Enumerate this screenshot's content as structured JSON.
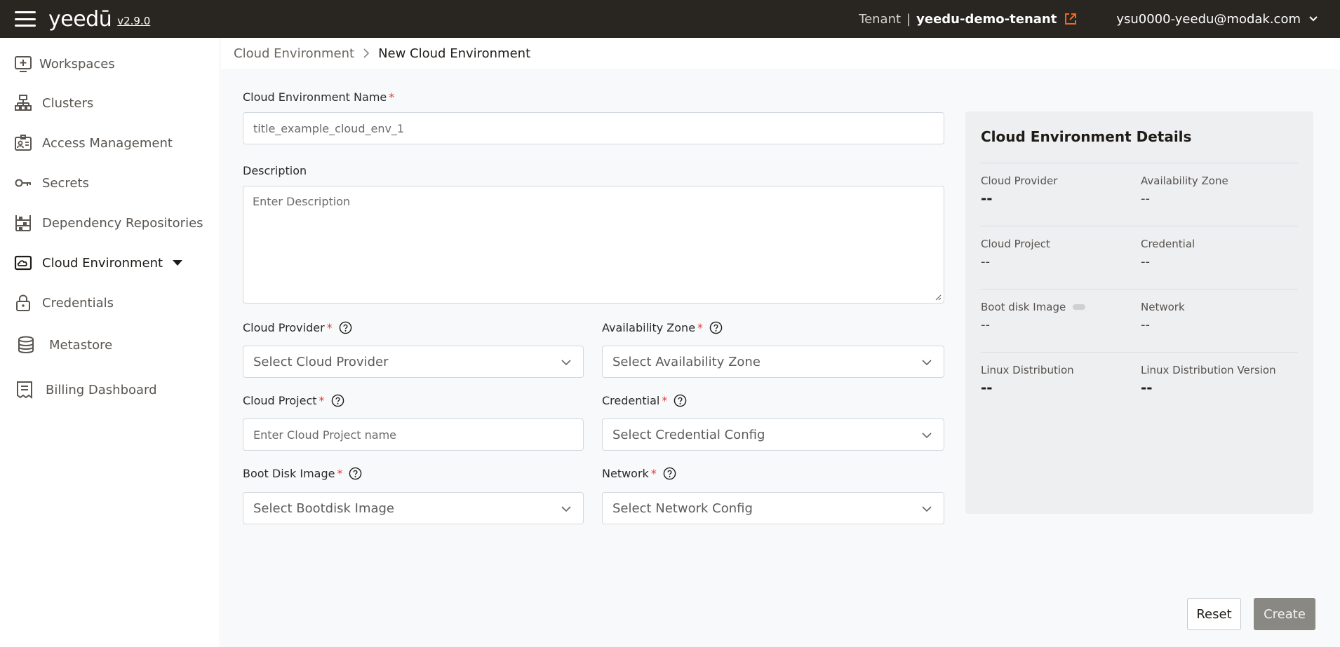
{
  "header": {
    "logo": "yeedū",
    "version": "v2.9.0",
    "tenant_label": "Tenant",
    "tenant_separator": "|",
    "tenant_name": "yeedu-demo-tenant",
    "user_email": "ysu0000-yeedu@modak.com",
    "accent_color": "#f26522"
  },
  "sidebar": {
    "items": [
      {
        "label": "Workspaces",
        "icon": "workspace-add-icon"
      },
      {
        "label": "Clusters",
        "icon": "cluster-tree-icon"
      },
      {
        "label": "Access Management",
        "icon": "id-badge-icon"
      },
      {
        "label": "Secrets",
        "icon": "key-icon"
      },
      {
        "label": "Dependency Repositories",
        "icon": "repository-shelf-icon"
      },
      {
        "label": "Cloud Environment",
        "icon": "cloud-box-icon",
        "active": true
      },
      {
        "label": "Credentials",
        "icon": "lock-icon"
      },
      {
        "label": "Metastore",
        "icon": "database-icon"
      },
      {
        "label": "Billing Dashboard",
        "icon": "receipt-icon"
      }
    ]
  },
  "breadcrumb": {
    "parent": "Cloud Environment",
    "current": "New Cloud Environment"
  },
  "form": {
    "name": {
      "label": "Cloud Environment Name",
      "required_mark": "*",
      "value": "title_example_cloud_env_1"
    },
    "description": {
      "label": "Description",
      "placeholder": "Enter Description"
    },
    "cloud_provider": {
      "label": "Cloud Provider",
      "required_mark": "*",
      "placeholder": "Select Cloud Provider"
    },
    "availability_zone": {
      "label": "Availability Zone",
      "required_mark": "*",
      "placeholder": "Select Availability Zone"
    },
    "cloud_project": {
      "label": "Cloud Project",
      "required_mark": "*",
      "placeholder": "Enter Cloud Project name"
    },
    "credential": {
      "label": "Credential",
      "required_mark": "*",
      "placeholder": "Select Credential Config"
    },
    "boot_disk_image": {
      "label": "Boot Disk Image",
      "required_mark": "*",
      "placeholder": "Select Bootdisk Image"
    },
    "network": {
      "label": "Network",
      "required_mark": "*",
      "placeholder": "Select Network Config"
    }
  },
  "details": {
    "title": "Cloud Environment Details",
    "fields": [
      {
        "label": "Cloud Provider",
        "value": "--"
      },
      {
        "label": "Availability Zone",
        "value": "--"
      },
      {
        "label": "Cloud Project",
        "value": "--"
      },
      {
        "label": "Credential",
        "value": "--"
      },
      {
        "label": "Boot disk Image",
        "value": "--"
      },
      {
        "label": "Network",
        "value": "--"
      },
      {
        "label": "Linux Distribution",
        "value": "--"
      },
      {
        "label": "Linux Distribution Version",
        "value": "--"
      }
    ]
  },
  "actions": {
    "reset": "Reset",
    "create": "Create"
  }
}
